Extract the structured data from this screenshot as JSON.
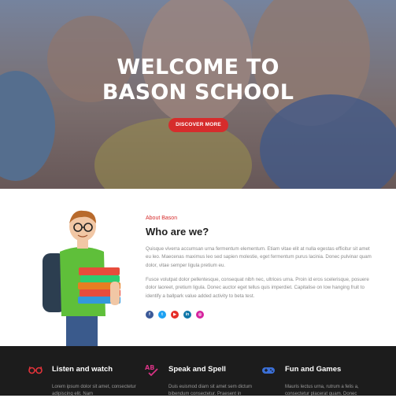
{
  "hero": {
    "title_line1": "WELCOME TO",
    "title_line2": "BASON SCHOOL",
    "button_label": "DISCOVER MORE"
  },
  "about": {
    "kicker": "About Bason",
    "title": "Who are we?",
    "paragraph1": "Quisque viverra accumsan urna fermentum elementum. Etiam vitae elit at nulla egestas efficitur sit amet eu leo. Maecenas maximus leo sed sapien molestie, eget fermentum purus lacinia. Donec pulvinar quam dolor, vitae semper ligula pretium eu.",
    "paragraph2": "Fusce volutpat dolor pellentesque, consequat nibh nec, ultrices urna. Proin id eros scelerisque, posuere dolor laoreet, pretium ligula. Donec auctor eget tellus quis imperdiet. Capitalise on low hanging fruit to identify a ballpark value added activity to beta test.",
    "socials": [
      {
        "name": "facebook-icon",
        "glyph": "f",
        "color": "#3b5998"
      },
      {
        "name": "twitter-icon",
        "glyph": "t",
        "color": "#1da1f2"
      },
      {
        "name": "youtube-icon",
        "glyph": "▶",
        "color": "#e52d27"
      },
      {
        "name": "linkedin-icon",
        "glyph": "in",
        "color": "#0e76a8"
      },
      {
        "name": "instagram-icon",
        "glyph": "◎",
        "color": "#d6249f"
      }
    ]
  },
  "features": [
    {
      "title": "Listen and watch",
      "text": "Lorem ipsum dolor sit amet, consectetur adipiscing elit. Nam",
      "icon": "glasses-icon",
      "color": "#e0333a"
    },
    {
      "title": "Speak and Spell",
      "text": "Duis euismod diam sit amet sem dictum bibendum consectetur. Praesent in",
      "icon": "spellcheck-icon",
      "color": "#d63384"
    },
    {
      "title": "Fun and Games",
      "text": "Mauris lectus urna, rutrum a felis a, consectetur placerat quam. Donec",
      "icon": "gamepad-icon",
      "color": "#3b6fd6"
    }
  ]
}
